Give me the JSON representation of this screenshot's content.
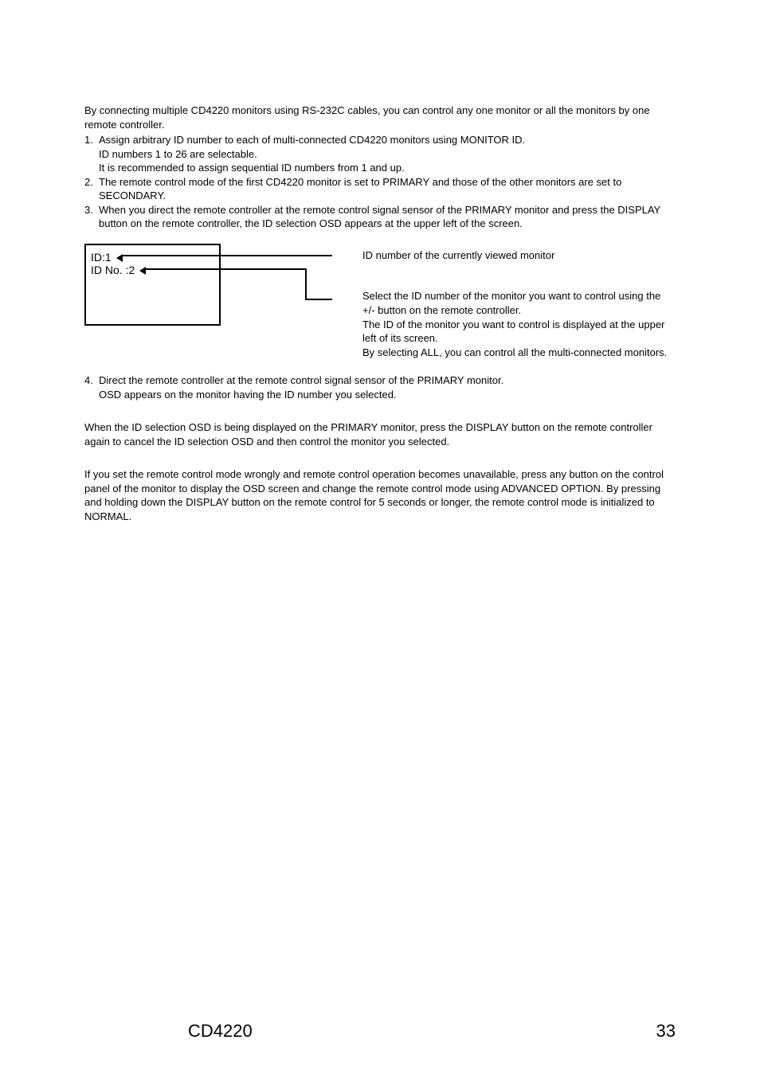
{
  "intro": "By connecting multiple CD4220 monitors using RS-232C cables, you can control any one monitor or all the monitors by one remote controller.",
  "steps": {
    "s1": {
      "num": "1.",
      "line1": "Assign arbitrary ID number to each of multi-connected CD4220 monitors using MONITOR ID.",
      "line2": "ID numbers 1 to 26 are selectable.",
      "line3": "It is recommended to assign sequential ID numbers from 1 and up."
    },
    "s2": {
      "num": "2.",
      "text": "The remote control mode of the first CD4220 monitor is set to PRIMARY and those of the other monitors are set to SECONDARY."
    },
    "s3": {
      "num": "3.",
      "text": "When you direct the remote controller at the remote control signal sensor of the PRIMARY monitor and press the DISPLAY button on the remote controller, the ID selection OSD appears at the upper left of the screen."
    },
    "s4": {
      "num": "4.",
      "line1": "Direct the remote controller at the remote control signal sensor of the PRIMARY monitor.",
      "line2": "OSD appears on the monitor having the ID number you selected."
    }
  },
  "osd": {
    "line1": "ID:1",
    "line2": "ID No. :2"
  },
  "callouts": {
    "top": "ID number of the currently viewed monitor",
    "bottom_l1": "Select the ID number of the monitor you want to control using the +/- button on the remote controller.",
    "bottom_l2": "The ID of the monitor you want to control is displayed at the upper left of its screen.",
    "bottom_l3": "By selecting ALL, you can control all the multi-connected monitors."
  },
  "note1": "When the ID selection OSD is being displayed on the PRIMARY monitor, press the DISPLAY button on the remote controller again to cancel the ID selection OSD and then control the monitor you selected.",
  "note2": "If you set the remote control mode wrongly and remote control operation becomes unavailable, press any button on the control panel of the monitor to display the OSD screen and change the remote control mode using ADVANCED OPTION. By pressing and holding down the DISPLAY button on the remote control for 5 seconds or longer, the remote control mode is initialized to NORMAL.",
  "footer": {
    "model": "CD4220",
    "page": "33"
  }
}
